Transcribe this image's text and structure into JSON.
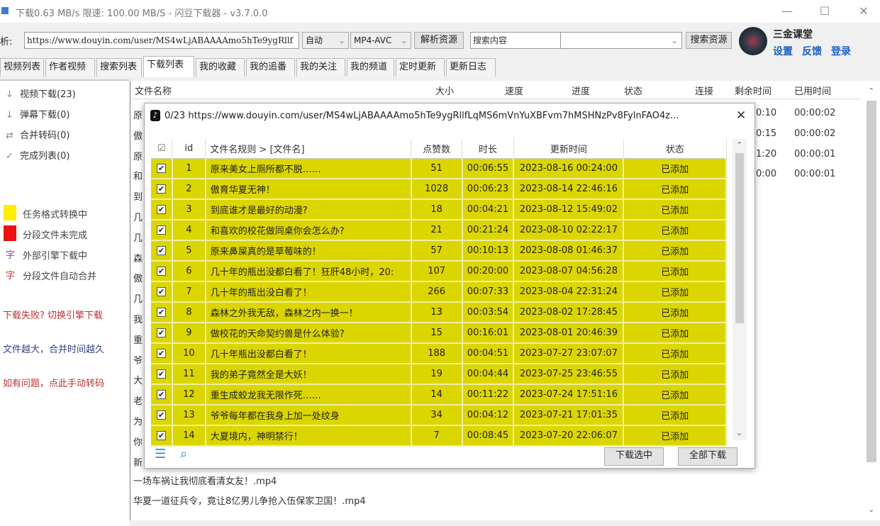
{
  "window": {
    "title": "下载0.63 MB/s  限速: 100.00 MB/S  - 闪豆下载器 - v3.7.0.0",
    "minimize": "—",
    "maximize": "☐",
    "close": "✕"
  },
  "toolbar": {
    "label": "析:",
    "url": "https://www.douyin.com/user/MS4wLjABAAAAmo5hTe9ygRllf",
    "quality": "自动",
    "format": "MP4-AVC",
    "parse_button": "解析资源",
    "search_placeholder": "搜索内容",
    "search_dropdown": "",
    "search_button": "搜索资源"
  },
  "user": {
    "name": "三金课堂",
    "settings": "设置",
    "feedback": "反馈",
    "login": "登录"
  },
  "tabs": [
    "视频列表",
    "作者视频",
    "搜索列表",
    "下载列表",
    "我的收藏",
    "我的追番",
    "我的关注",
    "我的频道",
    "定时更新",
    "更新日志"
  ],
  "active_tab": "下载列表",
  "sidebar": {
    "items": [
      {
        "icon": "↓",
        "label": "视频下载(23)"
      },
      {
        "icon": "↓",
        "label": "弹幕下载(0)"
      },
      {
        "icon": "⇄",
        "label": "合并转码(0)"
      },
      {
        "icon": "✓",
        "label": "完成列表(0)"
      }
    ],
    "legend": [
      {
        "color": "#ffee00",
        "label": "任务格式转换中"
      },
      {
        "color": "#ee1111",
        "label": "分段文件未完成"
      },
      {
        "glyph": "字",
        "glyph_color": "#8844aa",
        "label": "外部引擎下载中"
      },
      {
        "glyph": "字",
        "glyph_color": "#cc3344",
        "label": "分段文件自动合并"
      }
    ],
    "links": [
      {
        "label": "下载失败? 切换引擎下载",
        "color": "#c03030"
      },
      {
        "label": "文件越大，合并时间越久",
        "color": "#334488"
      },
      {
        "label": "如有问题，点此手动转码",
        "color": "#c03030"
      }
    ]
  },
  "download_list": {
    "columns": [
      "文件名称",
      "大小",
      "速度",
      "进度",
      "状态",
      "连接",
      "剩余时间",
      "已用时间"
    ],
    "row_initials": [
      "原",
      "傲",
      "原",
      "和",
      "到",
      "几",
      "几",
      "森",
      "傲",
      "几",
      "我",
      "重",
      "爷",
      "大",
      "老",
      "为",
      "你",
      "新"
    ],
    "remaining": [
      "0:10",
      "0:15",
      "1:20",
      "0:00"
    ],
    "elapsed": [
      "00:00:02",
      "00:00:02",
      "00:00:01",
      "00:00:01"
    ],
    "visible_rows": [
      "一场车祸让我彻底看清女友！.mp4",
      "华夏一道征兵令，竟让8亿男儿争抢入伍保家卫国！.mp4"
    ]
  },
  "dialog": {
    "title": "0/23 https://www.douyin.com/user/MS4wLjABAAAAmo5hTe9ygRllfLqMS6mVnYuXBFvm7hMSHNzPv8FylnFAO4z...",
    "close": "✕",
    "columns": [
      "id",
      "文件名规则  >  [文件名]",
      "点赞数",
      "时长",
      "更新时间",
      "状态"
    ],
    "rows": [
      [
        "1",
        "原来美女上厕所都不脱……",
        "51",
        "00:06:55",
        "2023-08-16 00:24:00",
        "已添加"
      ],
      [
        "2",
        "傲育华夏无神！",
        "1028",
        "00:06:23",
        "2023-08-14 22:46:16",
        "已添加"
      ],
      [
        "3",
        "到底谁才是最好的动漫?",
        "18",
        "00:04:21",
        "2023-08-12 15:49:02",
        "已添加"
      ],
      [
        "4",
        "和喜欢的校花做同桌你会怎么办?",
        "21",
        "00:21:24",
        "2023-08-10 02:22:17",
        "已添加"
      ],
      [
        "5",
        "原来鼻屎真的是草莓味的！",
        "57",
        "00:10:13",
        "2023-08-08 01:46:37",
        "已添加"
      ],
      [
        "6",
        "几十年的瓶出没都白看了！狂肝48小时，20:",
        "107",
        "00:20:00",
        "2023-08-07 04:56:28",
        "已添加"
      ],
      [
        "7",
        "几十年的瓶出没白看了！",
        "266",
        "00:07:33",
        "2023-08-04 22:31:24",
        "已添加"
      ],
      [
        "8",
        "森林之外我无敌，森林之内一换一！",
        "13",
        "00:03:54",
        "2023-08-02 17:28:45",
        "已添加"
      ],
      [
        "9",
        "做校花的天命契约兽是什么体验?",
        "15",
        "00:16:01",
        "2023-08-01 20:46:39",
        "已添加"
      ],
      [
        "10",
        "几十年瓶出没都白看了！",
        "188",
        "00:04:51",
        "2023-07-27 23:07:07",
        "已添加"
      ],
      [
        "11",
        "我的弟子竟然全是大妖！",
        "19",
        "00:04:44",
        "2023-07-25 23:46:55",
        "已添加"
      ],
      [
        "12",
        "重生成蛟龙我无限作死……",
        "14",
        "00:11:22",
        "2023-07-24 17:51:16",
        "已添加"
      ],
      [
        "13",
        "爷爷每年都在我身上加一处纹身",
        "34",
        "00:04:12",
        "2023-07-21 17:01:35",
        "已添加"
      ],
      [
        "14",
        "大夏境内，神明禁行！",
        "7",
        "00:08:45",
        "2023-07-20 22:06:07",
        "已添加"
      ]
    ],
    "row_color": "#dcd600",
    "download_selected": "下载选中",
    "download_all": "全部下载"
  }
}
